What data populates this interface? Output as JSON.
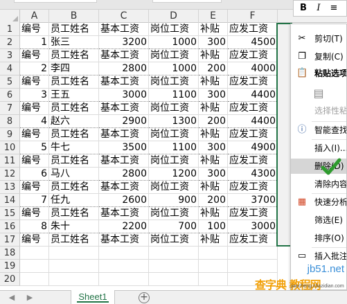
{
  "columns": [
    "A",
    "B",
    "C",
    "D",
    "E",
    "F"
  ],
  "row_numbers": [
    "1",
    "2",
    "3",
    "4",
    "5",
    "6",
    "7",
    "8",
    "9",
    "10",
    "11",
    "12",
    "13",
    "14",
    "15",
    "16",
    "17",
    "18",
    "19",
    "20"
  ],
  "rows": [
    [
      "编号",
      "员工姓名",
      "基本工资",
      "岗位工资",
      "补贴",
      "应发工资"
    ],
    [
      "1",
      "张三",
      "3200",
      "1000",
      "300",
      "4500"
    ],
    [
      "编号",
      "员工姓名",
      "基本工资",
      "岗位工资",
      "补贴",
      "应发工资"
    ],
    [
      "2",
      "李四",
      "2800",
      "1000",
      "200",
      "4000"
    ],
    [
      "编号",
      "员工姓名",
      "基本工资",
      "岗位工资",
      "补贴",
      "应发工资"
    ],
    [
      "3",
      "王五",
      "3000",
      "1100",
      "300",
      "4400"
    ],
    [
      "编号",
      "员工姓名",
      "基本工资",
      "岗位工资",
      "补贴",
      "应发工资"
    ],
    [
      "4",
      "赵六",
      "2900",
      "1300",
      "200",
      "4400"
    ],
    [
      "编号",
      "员工姓名",
      "基本工资",
      "岗位工资",
      "补贴",
      "应发工资"
    ],
    [
      "5",
      "牛七",
      "3500",
      "1100",
      "300",
      "4900"
    ],
    [
      "编号",
      "员工姓名",
      "基本工资",
      "岗位工资",
      "补贴",
      "应发工资"
    ],
    [
      "6",
      "马八",
      "2800",
      "1200",
      "300",
      "4300"
    ],
    [
      "编号",
      "员工姓名",
      "基本工资",
      "岗位工资",
      "补贴",
      "应发工资"
    ],
    [
      "7",
      "任九",
      "2600",
      "900",
      "200",
      "3700"
    ],
    [
      "编号",
      "员工姓名",
      "基本工资",
      "岗位工资",
      "补贴",
      "应发工资"
    ],
    [
      "8",
      "朱十",
      "2200",
      "700",
      "100",
      "3000"
    ],
    [
      "编号",
      "员工姓名",
      "基本工资",
      "岗位工资",
      "补贴",
      "应发工资"
    ]
  ],
  "sheet_tab": "Sheet1",
  "add_sheet_symbol": "+",
  "mini_toolbar": {
    "bold": "B",
    "italic": "I",
    "align": "≡"
  },
  "context_menu": {
    "cut": "剪切(T)",
    "copy": "复制(C)",
    "paste_options": "粘贴选项:",
    "paste_special": "选择性粘贴...",
    "smart_lookup": "智能查找(L)",
    "insert": "插入(I)...",
    "delete": "删除(D)",
    "clear": "清除内容(N)",
    "quick_analysis": "快速分析(Q)",
    "filter": "筛选(E)",
    "sort": "排序(O)",
    "insert_comment": "插入批注(M)"
  },
  "watermark": {
    "site": "jb51.net",
    "brand": "查字典 教程网",
    "url": "jiaocheng.chazidian.com"
  },
  "colors": {
    "accent": "#217346",
    "check": "#2e9b2e"
  }
}
